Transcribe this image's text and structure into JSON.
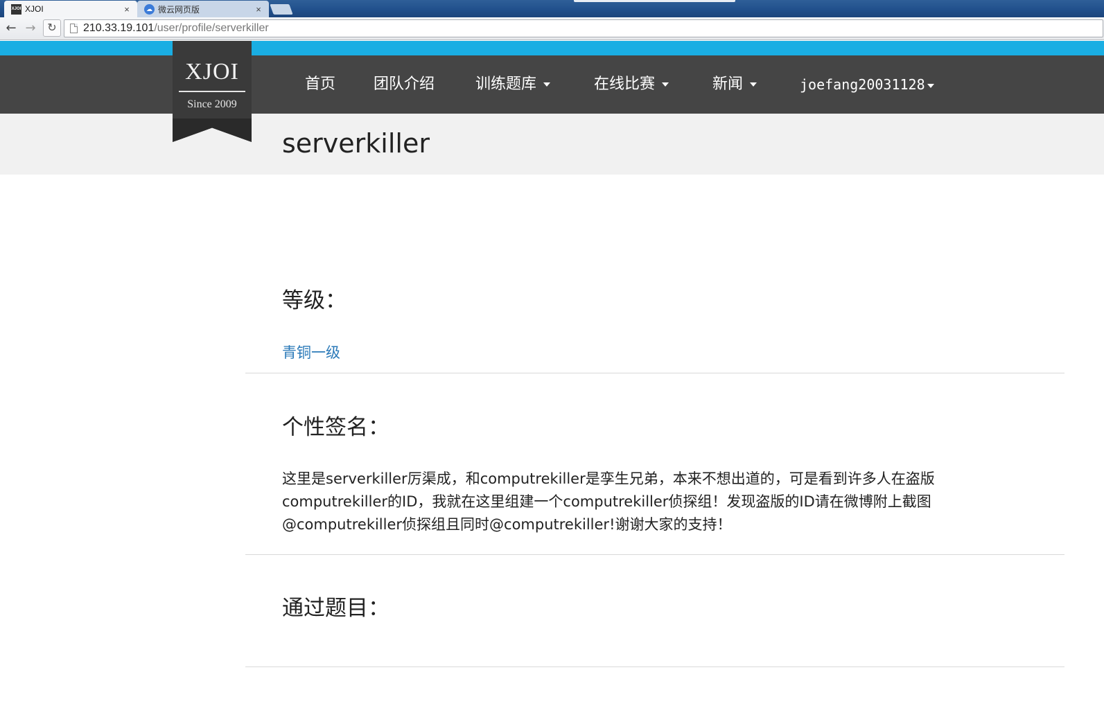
{
  "browser": {
    "tabs": [
      {
        "title": "XJOI",
        "favicon": "XJOI",
        "close": "×"
      },
      {
        "title": "微云网页版",
        "favicon": "☁",
        "close": "×"
      }
    ],
    "back_icon": "←",
    "forward_icon": "→",
    "reload_icon": "↻",
    "url_host": "210.33.19.101",
    "url_path": "/user/profile/serverkiller"
  },
  "site": {
    "logo": {
      "name": "XJOI",
      "since": "Since 2009"
    },
    "nav": [
      {
        "label": "首页"
      },
      {
        "label": "团队介绍"
      },
      {
        "label": "训练题库"
      },
      {
        "label": "在线比赛"
      },
      {
        "label": "新闻"
      },
      {
        "label": "joefang20031128"
      }
    ],
    "accent_color": "#1aaee3",
    "nav_background": "#454545"
  },
  "profile": {
    "username": "serverkiller",
    "level_heading": "等级：",
    "level_value": "青铜一级",
    "signature_heading": "个性签名：",
    "signature_lines": [
      "这里是serverkiller厉渠成，和computrekiller是孪生兄弟，本来不想出道的，可是看到许多人在盗版",
      "computrekiller的ID，我就在这里组建一个computrekiller侦探组！发现盗版的ID请在微博附上截图",
      "@computrekiller侦探组且同时@computrekiller!谢谢大家的支持！"
    ],
    "solved_heading": "通过题目："
  }
}
